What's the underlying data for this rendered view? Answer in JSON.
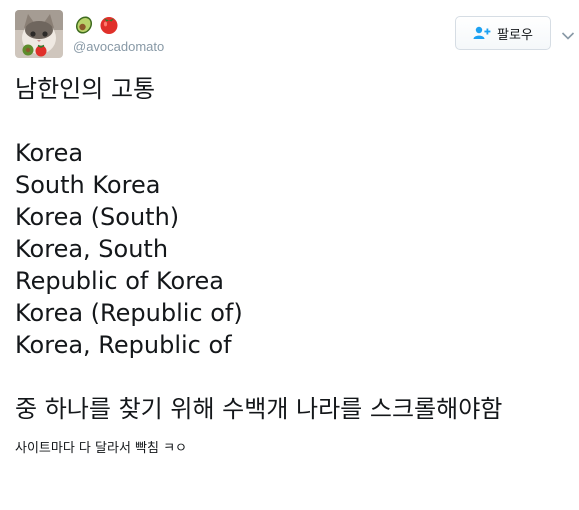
{
  "user": {
    "display_name_icons": [
      "avocado-emoji",
      "tomato-emoji"
    ],
    "handle": "@avocadomato"
  },
  "follow_button": {
    "label": "팔로우",
    "icon": "add-user-icon"
  },
  "body": {
    "title": "남한인의 고통",
    "country_names": [
      "Korea",
      "South Korea",
      "Korea (South)",
      "Korea, South",
      "Republic of Korea",
      "Korea (Republic of)",
      "Korea, Republic of"
    ],
    "tail_text": "중 하나를 찾기 위해 수백개 나라를 스크롤해야함",
    "small_text": "사이트마다 다 달라서 빡침 ㅋㅇ"
  },
  "colors": {
    "accent": "#1da1f2",
    "handle_gray": "#8899a6",
    "text": "#14171a"
  }
}
